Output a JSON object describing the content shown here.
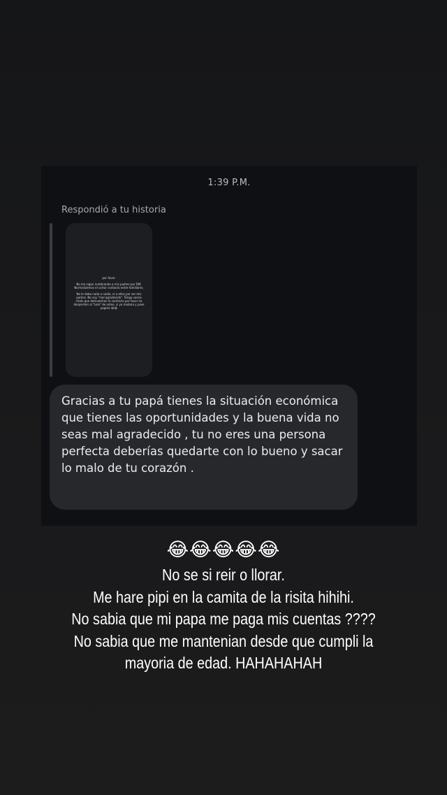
{
  "dm": {
    "time": "1:39 P.M.",
    "reply_label": "Respondió a tu historia",
    "story_preview": {
      "lines": [
        "por favor.",
        "No me sigan nombrando a mis padres por DM. Normalizemos el cortar contacto entre familiares.",
        "No le debo nada a nadie, ni a ellos por ser mis padres. No soy \"mal agradecido\". Tengo varios chats que demuestran lo contrario por favor no despierten al \"Lolo\" de antes, si ya maduro y pase pagina 😂😂"
      ]
    },
    "message": "Gracias a tu papá tienes la situación económica que tienes las oportunidades y la buena vida no seas mal agradecido , tu no eres una persona perfecta deberías quedarte con lo bueno y sacar lo malo de tu corazón ."
  },
  "overlay": {
    "emojis": "😂😂😂😂😂",
    "lines": [
      "No se si reir o llorar.",
      "Me hare pipi en la camita de la risita hihihi.",
      "No sabia que mi papa me paga mis cuentas ????",
      "No sabia que me mantenian desde que cumpli la",
      "mayoria de edad. HAHAHAHAH"
    ]
  }
}
